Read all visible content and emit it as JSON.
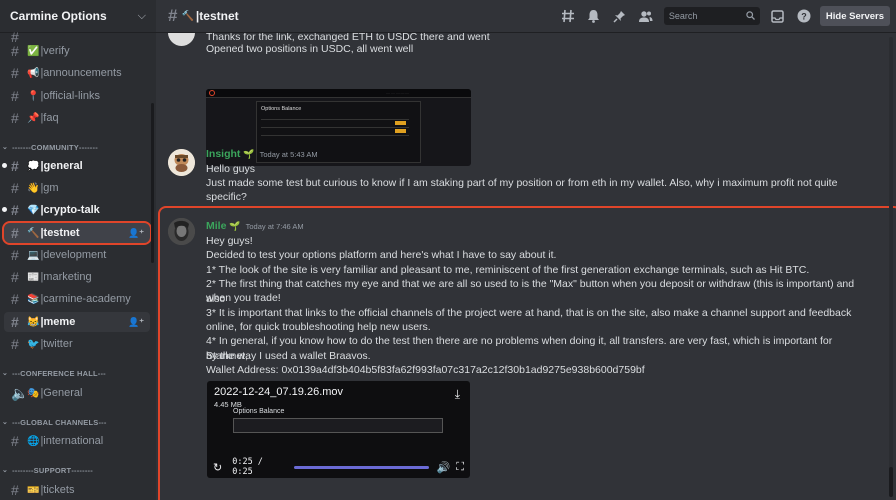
{
  "server": {
    "name": "Carmine Options"
  },
  "sidebar": {
    "channels": [
      {
        "id": "verify",
        "emoji": "✅",
        "label": "|verify"
      },
      {
        "id": "announcements",
        "emoji": "📢",
        "label": "|announcements"
      },
      {
        "id": "official-links",
        "emoji": "📍",
        "label": "|official-links"
      },
      {
        "id": "faq",
        "emoji": "📌",
        "label": "|faq"
      }
    ],
    "categories": {
      "community": "COMMUNITY",
      "conference": "CONFERENCE HALL",
      "global": "GLOBAL CHANNELS",
      "support": "SUPPORT"
    },
    "community_channels": [
      {
        "emoji": "💭",
        "label": "|general"
      },
      {
        "emoji": "👋",
        "label": "|gm"
      },
      {
        "emoji": "💎",
        "label": "|crypto-talk"
      },
      {
        "emoji": "🔨",
        "label": "|testnet"
      },
      {
        "emoji": "💻",
        "label": "|development"
      },
      {
        "emoji": "📰",
        "label": "|marketing"
      },
      {
        "emoji": "📚",
        "label": "|carmine-academy"
      },
      {
        "emoji": "😹",
        "label": "|meme"
      },
      {
        "emoji": "🐦",
        "label": "|twitter"
      }
    ],
    "conference_channels": [
      {
        "emoji": "🎭",
        "label": "|General"
      }
    ],
    "global_channels": [
      {
        "emoji": "🌐",
        "label": "|international"
      }
    ],
    "support_channels": [
      {
        "emoji": "🎫",
        "label": "|tickets"
      }
    ]
  },
  "header": {
    "channel_emoji": "🔨",
    "channel_name": "|testnet",
    "search_placeholder": "Search",
    "hide_servers": "Hide Servers"
  },
  "messages": {
    "prev": {
      "line1": "Thanks for the link, exchanged ETH to USDC there and went",
      "line2": "Opened two positions in USDC, all went well",
      "image_title": "Options Balance"
    },
    "insight": {
      "author": "Insight",
      "time": "Today at 5:43 AM",
      "lines": [
        "Hello guys",
        "Just made some test but curious to know if I am staking part of my position or from eth in my wallet. Also, why i maximum profit not quite",
        "specific?"
      ]
    },
    "mile": {
      "author": "Mile",
      "time": "Today at 7:46 AM",
      "lines": [
        "Hey guys!",
        "Decided to test your options platform and here's what I have to say about it.",
        "1* The look of the site is very familiar and pleasant to me, reminiscent of the first generation exchange terminals, such as Hit BTC.",
        "2* The first thing that catches my eye and that we are all so used to is the \"Max\" button when you deposit or withdraw (this is important) and also",
        "when you trade!",
        "3* It is important that links to the official channels of the project were at hand, that is on the site, also make a channel support and feedback",
        "online, for quick troubleshooting help new users.",
        "4* In general, if you know how to do the test then there are no problems when doing it, all transfers. are very fast, which is important for Starknet,",
        "by the way I used a wallet Braavos.",
        "Wallet Address: 0x0139a4df3b404b5f83fa62f993fa07c317a2c12f30b1ad9275e938b600d759bf"
      ],
      "video": {
        "filename": "2022-12-24_07.19.26.mov",
        "size": "4.45 MB",
        "inner_title": "Options Balance",
        "time": "0:25 / 0:25"
      }
    }
  }
}
